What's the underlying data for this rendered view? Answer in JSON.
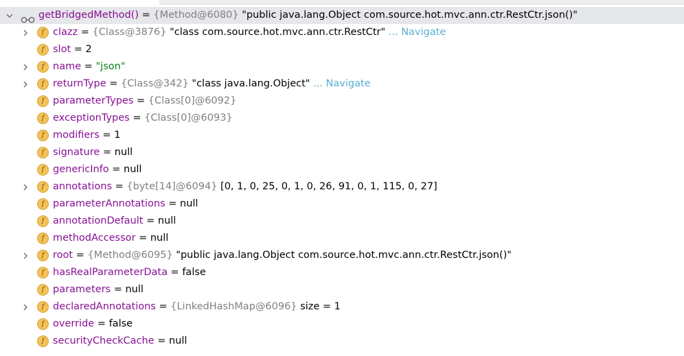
{
  "root": {
    "name": "getBridgedMethod()",
    "eq": " = ",
    "ref": "{Method@6080}",
    "value": " \"public java.lang.Object com.source.hot.mvc.ann.ctr.RestCtr.json()\""
  },
  "icons": {
    "expand": "chevron-right",
    "collapse": "chevron-down",
    "watch": "glasses-icon",
    "field": "field-icon",
    "field_letter": "f"
  },
  "colors": {
    "field_name": "#871094",
    "reference": "#808080",
    "string": "#067d17",
    "navigate": "#5ab0d2",
    "root_row_bg": "#e6e7ea",
    "field_badge": "#f4c25a"
  },
  "fields": [
    {
      "name": "clazz",
      "eq": " = ",
      "ref": "{Class@3876}",
      "value": " \"class com.source.hot.mvc.ann.ctr.RestCtr\"",
      "nav": " ... Navigate",
      "expandable": true,
      "value_type": "plain"
    },
    {
      "name": "slot",
      "eq": " = ",
      "ref": "",
      "value": "2",
      "nav": "",
      "expandable": false,
      "value_type": "plain"
    },
    {
      "name": "name",
      "eq": " = ",
      "ref": "",
      "value": "\"json\"",
      "nav": "",
      "expandable": true,
      "value_type": "string"
    },
    {
      "name": "returnType",
      "eq": " = ",
      "ref": "{Class@342}",
      "value": " \"class java.lang.Object\"",
      "nav": " ... Navigate",
      "expandable": true,
      "value_type": "plain"
    },
    {
      "name": "parameterTypes",
      "eq": " = ",
      "ref": "{Class[0]@6092}",
      "value": "",
      "nav": "",
      "expandable": false,
      "value_type": "plain"
    },
    {
      "name": "exceptionTypes",
      "eq": " = ",
      "ref": "{Class[0]@6093}",
      "value": "",
      "nav": "",
      "expandable": false,
      "value_type": "plain"
    },
    {
      "name": "modifiers",
      "eq": " = ",
      "ref": "",
      "value": "1",
      "nav": "",
      "expandable": false,
      "value_type": "plain"
    },
    {
      "name": "signature",
      "eq": " = ",
      "ref": "",
      "value": "null",
      "nav": "",
      "expandable": false,
      "value_type": "plain"
    },
    {
      "name": "genericInfo",
      "eq": " = ",
      "ref": "",
      "value": "null",
      "nav": "",
      "expandable": false,
      "value_type": "plain"
    },
    {
      "name": "annotations",
      "eq": " = ",
      "ref": "{byte[14]@6094}",
      "value": " [0, 1, 0, 25, 0, 1, 0, 26, 91, 0, 1, 115, 0, 27]",
      "nav": "",
      "expandable": true,
      "value_type": "plain"
    },
    {
      "name": "parameterAnnotations",
      "eq": " = ",
      "ref": "",
      "value": "null",
      "nav": "",
      "expandable": false,
      "value_type": "plain"
    },
    {
      "name": "annotationDefault",
      "eq": " = ",
      "ref": "",
      "value": "null",
      "nav": "",
      "expandable": false,
      "value_type": "plain"
    },
    {
      "name": "methodAccessor",
      "eq": " = ",
      "ref": "",
      "value": "null",
      "nav": "",
      "expandable": false,
      "value_type": "plain"
    },
    {
      "name": "root",
      "eq": " = ",
      "ref": "{Method@6095}",
      "value": " \"public java.lang.Object com.source.hot.mvc.ann.ctr.RestCtr.json()\"",
      "nav": "",
      "expandable": true,
      "value_type": "plain"
    },
    {
      "name": "hasRealParameterData",
      "eq": " = ",
      "ref": "",
      "value": "false",
      "nav": "",
      "expandable": false,
      "value_type": "plain"
    },
    {
      "name": "parameters",
      "eq": " = ",
      "ref": "",
      "value": "null",
      "nav": "",
      "expandable": false,
      "value_type": "plain"
    },
    {
      "name": "declaredAnnotations",
      "eq": " = ",
      "ref": "{LinkedHashMap@6096}",
      "value": "  size = 1",
      "nav": "",
      "expandable": true,
      "value_type": "plain"
    },
    {
      "name": "override",
      "eq": " = ",
      "ref": "",
      "value": "false",
      "nav": "",
      "expandable": false,
      "value_type": "plain"
    },
    {
      "name": "securityCheckCache",
      "eq": " = ",
      "ref": "",
      "value": "null",
      "nav": "",
      "expandable": false,
      "value_type": "plain"
    }
  ]
}
